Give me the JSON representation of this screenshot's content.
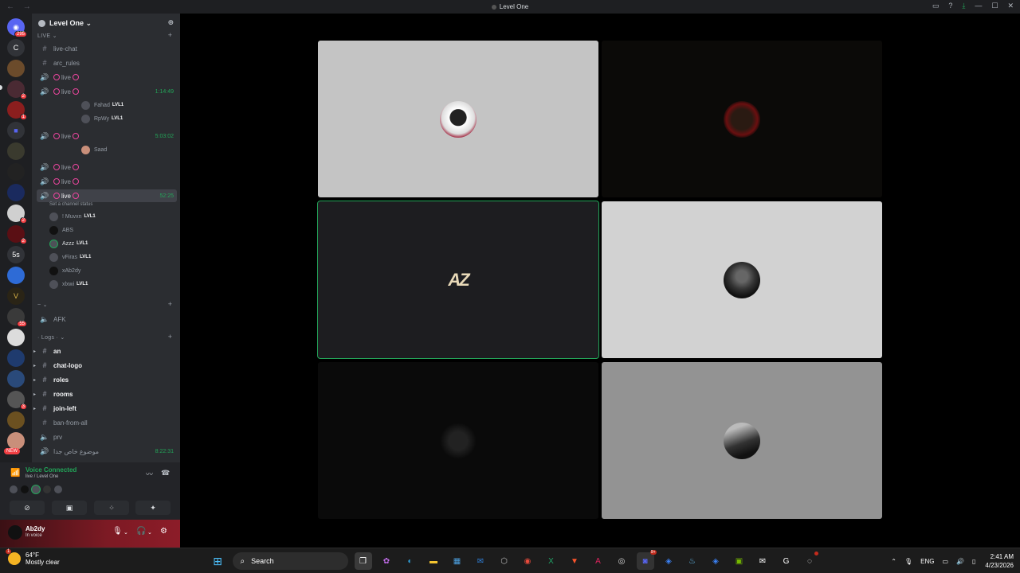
{
  "window": {
    "title": "Level One"
  },
  "server": {
    "name": "Level One",
    "chevron": "⌄"
  },
  "categories": {
    "live": "LIVE ⌄",
    "second": "~ ⌄",
    "logs": "· Logs · ⌄"
  },
  "channels": [
    {
      "name": "live-chat",
      "type": "text"
    },
    {
      "name": "arc_rules",
      "type": "text"
    },
    {
      "name": "live",
      "type": "voice"
    },
    {
      "name": "live",
      "type": "voice",
      "time": "1:14:49"
    },
    {
      "name": "live",
      "type": "voice",
      "time": "5:03:02"
    },
    {
      "name": "live",
      "type": "voice"
    },
    {
      "name": "live",
      "type": "voice"
    },
    {
      "name": "live",
      "type": "voice",
      "time": "52:25",
      "status": "Set a channel status"
    },
    {
      "name": "AFK",
      "type": "voice"
    },
    {
      "name": "an",
      "type": "text"
    },
    {
      "name": "chat-logo",
      "type": "text"
    },
    {
      "name": "roles",
      "type": "text"
    },
    {
      "name": "rooms",
      "type": "text"
    },
    {
      "name": "join-left",
      "type": "text"
    },
    {
      "name": "ban-from-all",
      "type": "text"
    },
    {
      "name": "prv",
      "type": "voice"
    },
    {
      "name": "موضوع خاص جدا",
      "type": "voice",
      "time": "8:22:31"
    }
  ],
  "voice_users": {
    "live2": [
      {
        "name": "Fahad",
        "level": "LVL1"
      },
      {
        "name": "RpWy",
        "level": "LVL1"
      }
    ],
    "live3": [
      {
        "name": "Saad"
      }
    ],
    "live6": [
      {
        "name": "! Muvxn",
        "level": "LVL1"
      },
      {
        "name": "ABS"
      },
      {
        "name": "Azzz",
        "level": "LVL1"
      },
      {
        "name": "vFiras",
        "level": "LVL1"
      },
      {
        "name": "xAb2dy"
      },
      {
        "name": "xlxwi",
        "level": "LVL1"
      }
    ]
  },
  "voice_panel": {
    "title": "Voice Connected",
    "subtitle": "live / Level One"
  },
  "user": {
    "name": "Ab2dy",
    "status": "In voice"
  },
  "servers": {
    "mentions_top": "295",
    "c_label": "C",
    "five_s": "5s",
    "new": "NEW",
    "badge_55": "55",
    "badge_3": "3",
    "badge_2": "2",
    "badge_1": "1"
  },
  "taskbar": {
    "weather_temp": "64°F",
    "weather_desc": "Mostly clear",
    "weather_badge": "1",
    "search": "Search",
    "lang": "ENG",
    "time": "2:41 AM",
    "date": "4/23/2026",
    "discord_badge": "9+"
  },
  "colors": {
    "voice_green": "#23a559",
    "live_pink": "#eb459e",
    "user_panel": "#8c1c28"
  }
}
